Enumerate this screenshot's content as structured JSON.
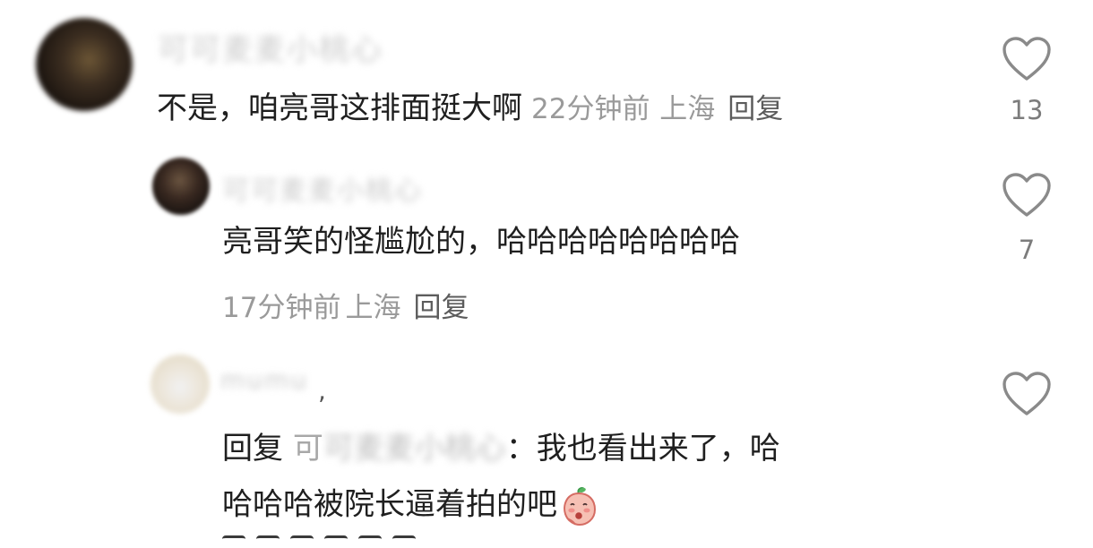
{
  "comments": [
    {
      "username": "可可麦麦小桃心",
      "text": "不是，咱亮哥这排面挺大啊",
      "time": "22分钟前",
      "location": "上海",
      "reply_label": "回复",
      "likes": "13",
      "avatar_icon": "avatar-blurred"
    },
    {
      "username": "可可麦麦小桃心",
      "text": "亮哥笑的怪尴尬的，哈哈哈哈哈哈哈哈",
      "time": "17分钟前",
      "location": "上海",
      "reply_label": "回复",
      "likes": "7",
      "avatar_icon": "avatar-blurred"
    },
    {
      "username": "mumu",
      "reply_prefix": "回复",
      "mention_visible": "可",
      "mention_blurred": "可麦麦小桃心",
      "text_line1": "：我也看出来了，哈",
      "text_line2": "哈哈哈被院长逼着拍的吧",
      "emoji": "peach-face-emoji",
      "avatar_icon": "avatar-blurred"
    }
  ],
  "icons": {
    "like": "heart-outline-icon"
  },
  "colors": {
    "text": "#1f1f1f",
    "meta": "#9a9a9a",
    "like_icon": "#8a8a8a"
  }
}
